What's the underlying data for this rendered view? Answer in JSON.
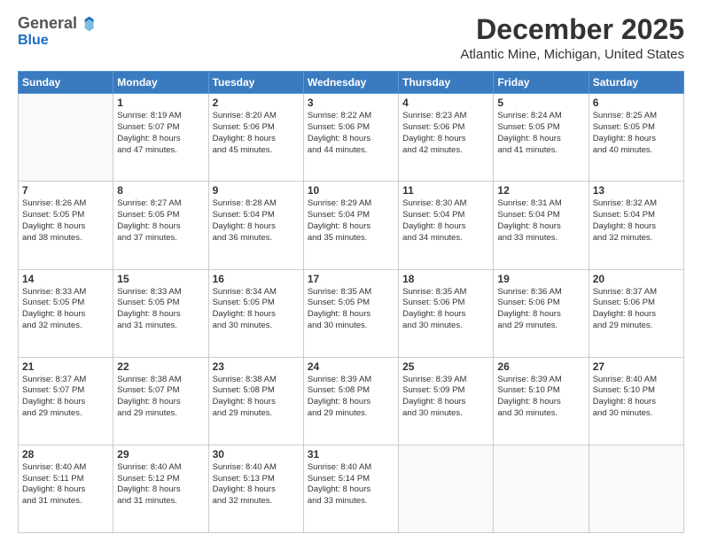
{
  "header": {
    "logo_general": "General",
    "logo_blue": "Blue",
    "month": "December 2025",
    "location": "Atlantic Mine, Michigan, United States"
  },
  "days_of_week": [
    "Sunday",
    "Monday",
    "Tuesday",
    "Wednesday",
    "Thursday",
    "Friday",
    "Saturday"
  ],
  "weeks": [
    [
      {
        "day": "",
        "info": ""
      },
      {
        "day": "1",
        "info": "Sunrise: 8:19 AM\nSunset: 5:07 PM\nDaylight: 8 hours\nand 47 minutes."
      },
      {
        "day": "2",
        "info": "Sunrise: 8:20 AM\nSunset: 5:06 PM\nDaylight: 8 hours\nand 45 minutes."
      },
      {
        "day": "3",
        "info": "Sunrise: 8:22 AM\nSunset: 5:06 PM\nDaylight: 8 hours\nand 44 minutes."
      },
      {
        "day": "4",
        "info": "Sunrise: 8:23 AM\nSunset: 5:06 PM\nDaylight: 8 hours\nand 42 minutes."
      },
      {
        "day": "5",
        "info": "Sunrise: 8:24 AM\nSunset: 5:05 PM\nDaylight: 8 hours\nand 41 minutes."
      },
      {
        "day": "6",
        "info": "Sunrise: 8:25 AM\nSunset: 5:05 PM\nDaylight: 8 hours\nand 40 minutes."
      }
    ],
    [
      {
        "day": "7",
        "info": "Sunrise: 8:26 AM\nSunset: 5:05 PM\nDaylight: 8 hours\nand 38 minutes."
      },
      {
        "day": "8",
        "info": "Sunrise: 8:27 AM\nSunset: 5:05 PM\nDaylight: 8 hours\nand 37 minutes."
      },
      {
        "day": "9",
        "info": "Sunrise: 8:28 AM\nSunset: 5:04 PM\nDaylight: 8 hours\nand 36 minutes."
      },
      {
        "day": "10",
        "info": "Sunrise: 8:29 AM\nSunset: 5:04 PM\nDaylight: 8 hours\nand 35 minutes."
      },
      {
        "day": "11",
        "info": "Sunrise: 8:30 AM\nSunset: 5:04 PM\nDaylight: 8 hours\nand 34 minutes."
      },
      {
        "day": "12",
        "info": "Sunrise: 8:31 AM\nSunset: 5:04 PM\nDaylight: 8 hours\nand 33 minutes."
      },
      {
        "day": "13",
        "info": "Sunrise: 8:32 AM\nSunset: 5:04 PM\nDaylight: 8 hours\nand 32 minutes."
      }
    ],
    [
      {
        "day": "14",
        "info": "Sunrise: 8:33 AM\nSunset: 5:05 PM\nDaylight: 8 hours\nand 32 minutes."
      },
      {
        "day": "15",
        "info": "Sunrise: 8:33 AM\nSunset: 5:05 PM\nDaylight: 8 hours\nand 31 minutes."
      },
      {
        "day": "16",
        "info": "Sunrise: 8:34 AM\nSunset: 5:05 PM\nDaylight: 8 hours\nand 30 minutes."
      },
      {
        "day": "17",
        "info": "Sunrise: 8:35 AM\nSunset: 5:05 PM\nDaylight: 8 hours\nand 30 minutes."
      },
      {
        "day": "18",
        "info": "Sunrise: 8:35 AM\nSunset: 5:06 PM\nDaylight: 8 hours\nand 30 minutes."
      },
      {
        "day": "19",
        "info": "Sunrise: 8:36 AM\nSunset: 5:06 PM\nDaylight: 8 hours\nand 29 minutes."
      },
      {
        "day": "20",
        "info": "Sunrise: 8:37 AM\nSunset: 5:06 PM\nDaylight: 8 hours\nand 29 minutes."
      }
    ],
    [
      {
        "day": "21",
        "info": "Sunrise: 8:37 AM\nSunset: 5:07 PM\nDaylight: 8 hours\nand 29 minutes."
      },
      {
        "day": "22",
        "info": "Sunrise: 8:38 AM\nSunset: 5:07 PM\nDaylight: 8 hours\nand 29 minutes."
      },
      {
        "day": "23",
        "info": "Sunrise: 8:38 AM\nSunset: 5:08 PM\nDaylight: 8 hours\nand 29 minutes."
      },
      {
        "day": "24",
        "info": "Sunrise: 8:39 AM\nSunset: 5:08 PM\nDaylight: 8 hours\nand 29 minutes."
      },
      {
        "day": "25",
        "info": "Sunrise: 8:39 AM\nSunset: 5:09 PM\nDaylight: 8 hours\nand 30 minutes."
      },
      {
        "day": "26",
        "info": "Sunrise: 8:39 AM\nSunset: 5:10 PM\nDaylight: 8 hours\nand 30 minutes."
      },
      {
        "day": "27",
        "info": "Sunrise: 8:40 AM\nSunset: 5:10 PM\nDaylight: 8 hours\nand 30 minutes."
      }
    ],
    [
      {
        "day": "28",
        "info": "Sunrise: 8:40 AM\nSunset: 5:11 PM\nDaylight: 8 hours\nand 31 minutes."
      },
      {
        "day": "29",
        "info": "Sunrise: 8:40 AM\nSunset: 5:12 PM\nDaylight: 8 hours\nand 31 minutes."
      },
      {
        "day": "30",
        "info": "Sunrise: 8:40 AM\nSunset: 5:13 PM\nDaylight: 8 hours\nand 32 minutes."
      },
      {
        "day": "31",
        "info": "Sunrise: 8:40 AM\nSunset: 5:14 PM\nDaylight: 8 hours\nand 33 minutes."
      },
      {
        "day": "",
        "info": ""
      },
      {
        "day": "",
        "info": ""
      },
      {
        "day": "",
        "info": ""
      }
    ]
  ]
}
